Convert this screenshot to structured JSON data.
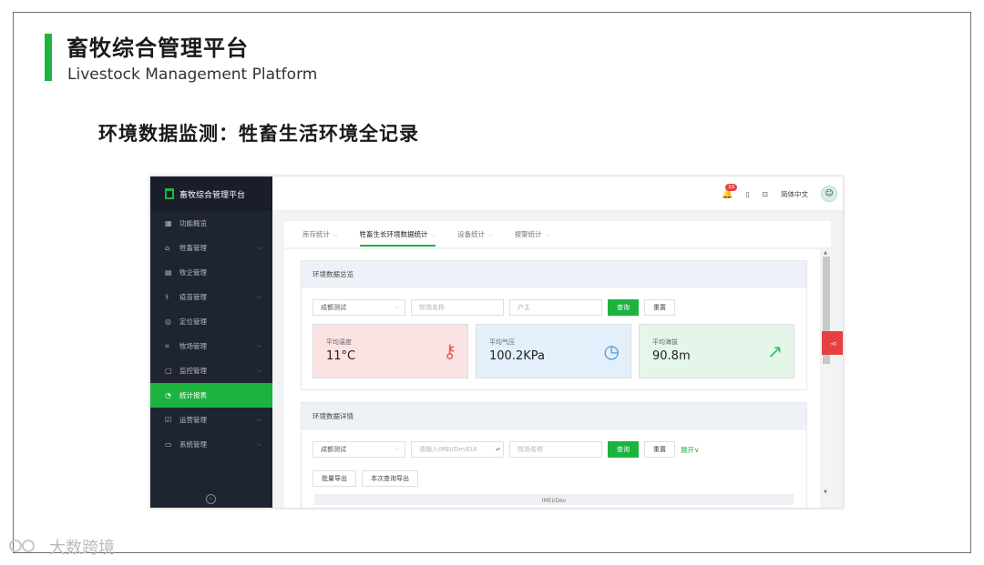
{
  "slide": {
    "title": "畜牧综合管理平台",
    "subtitle": "Livestock Management Platform",
    "section_title": "环境数据监测：牲畜生活环境全记录",
    "watermark": "大数跨境",
    "accent_color": "#1db33f"
  },
  "app": {
    "brand_name": "畜牧综合管理平台",
    "sidebar": {
      "items": [
        {
          "label": "功能概览",
          "icon": "grid-icon",
          "has_children": false
        },
        {
          "label": "牲畜管理",
          "icon": "livestock-icon",
          "has_children": true
        },
        {
          "label": "牧企管理",
          "icon": "company-icon",
          "has_children": false
        },
        {
          "label": "疫苗管理",
          "icon": "vaccine-icon",
          "has_children": true
        },
        {
          "label": "定位管理",
          "icon": "location-icon",
          "has_children": false
        },
        {
          "label": "牧场管理",
          "icon": "ranch-icon",
          "has_children": true
        },
        {
          "label": "监控管理",
          "icon": "camera-icon",
          "has_children": true
        },
        {
          "label": "统计报表",
          "icon": "chart-pie-icon",
          "has_children": false,
          "active": true
        },
        {
          "label": "运营管理",
          "icon": "operation-icon",
          "has_children": true
        },
        {
          "label": "系统管理",
          "icon": "monitor-icon",
          "has_children": true
        }
      ]
    },
    "topbar": {
      "notification_count": "10",
      "language": "简体中文"
    },
    "tabs": [
      {
        "label": "库存统计",
        "active": false
      },
      {
        "label": "牲畜生长环境数据统计",
        "active": true
      },
      {
        "label": "设备统计",
        "active": false
      },
      {
        "label": "报警统计",
        "active": false
      }
    ],
    "overview": {
      "title": "环境数据总览",
      "filters": {
        "select_value": "成都测试",
        "ranch_placeholder": "牧场名称",
        "farmer_placeholder": "户主",
        "query_label": "查询",
        "reset_label": "重置"
      },
      "cards": [
        {
          "label": "平均温度",
          "value": "11°C",
          "icon": "thermometer-icon",
          "bg": "#fbe3e3",
          "icon_color": "#e85a5a"
        },
        {
          "label": "平均气压",
          "value": "100.2KPa",
          "icon": "gauge-icon",
          "bg": "#e3effb",
          "icon_color": "#3f8fd6"
        },
        {
          "label": "平均海拔",
          "value": "90.8m",
          "icon": "trend-up-icon",
          "bg": "#e4f6ea",
          "icon_color": "#2fbf63"
        }
      ]
    },
    "detail": {
      "title": "环境数据详情",
      "filters": {
        "select_value": "成都测试",
        "imei_placeholder": "请输入IMEI/DevEUI",
        "ranch_placeholder": "牧场名称",
        "query_label": "查询",
        "reset_label": "重置",
        "expand_label": "展开"
      },
      "actions": {
        "batch_export": "批量导出",
        "query_export": "本次查询导出"
      },
      "table_header": "IMEI/Dev"
    }
  }
}
